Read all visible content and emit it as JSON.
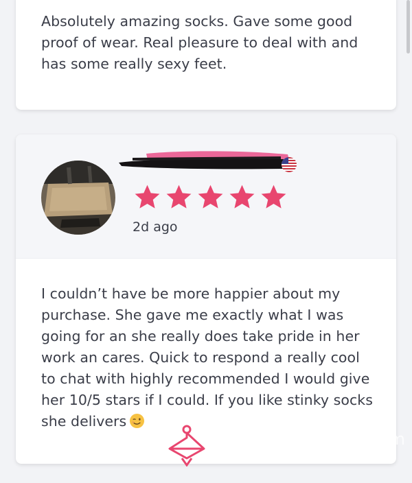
{
  "reviews": [
    {
      "text": "Absolutely amazing socks. Gave some good proof of wear. Real pleasure to deal with and has some really sexy feet."
    },
    {
      "rating": 5,
      "max_rating": 5,
      "time": "2d ago",
      "text": "I couldn’t have be more happier about my purchase. She gave me exactly what I was going for an she really does take pride in her work an cares. Quick to respond a really cool to chat with highly recommended I would give her 10/5 stars if I could. If you like stinky socks she delivers",
      "emoji": "wink-emoji-icon",
      "country_flag": "us-flag-icon"
    }
  ],
  "watermark": {
    "icon": "hanger-logo-icon",
    "text": ".com"
  },
  "colors": {
    "star": "#e8466f",
    "text": "#3a3d48",
    "header_bg": "#f5f6f9",
    "redaction": "#e94f88"
  }
}
